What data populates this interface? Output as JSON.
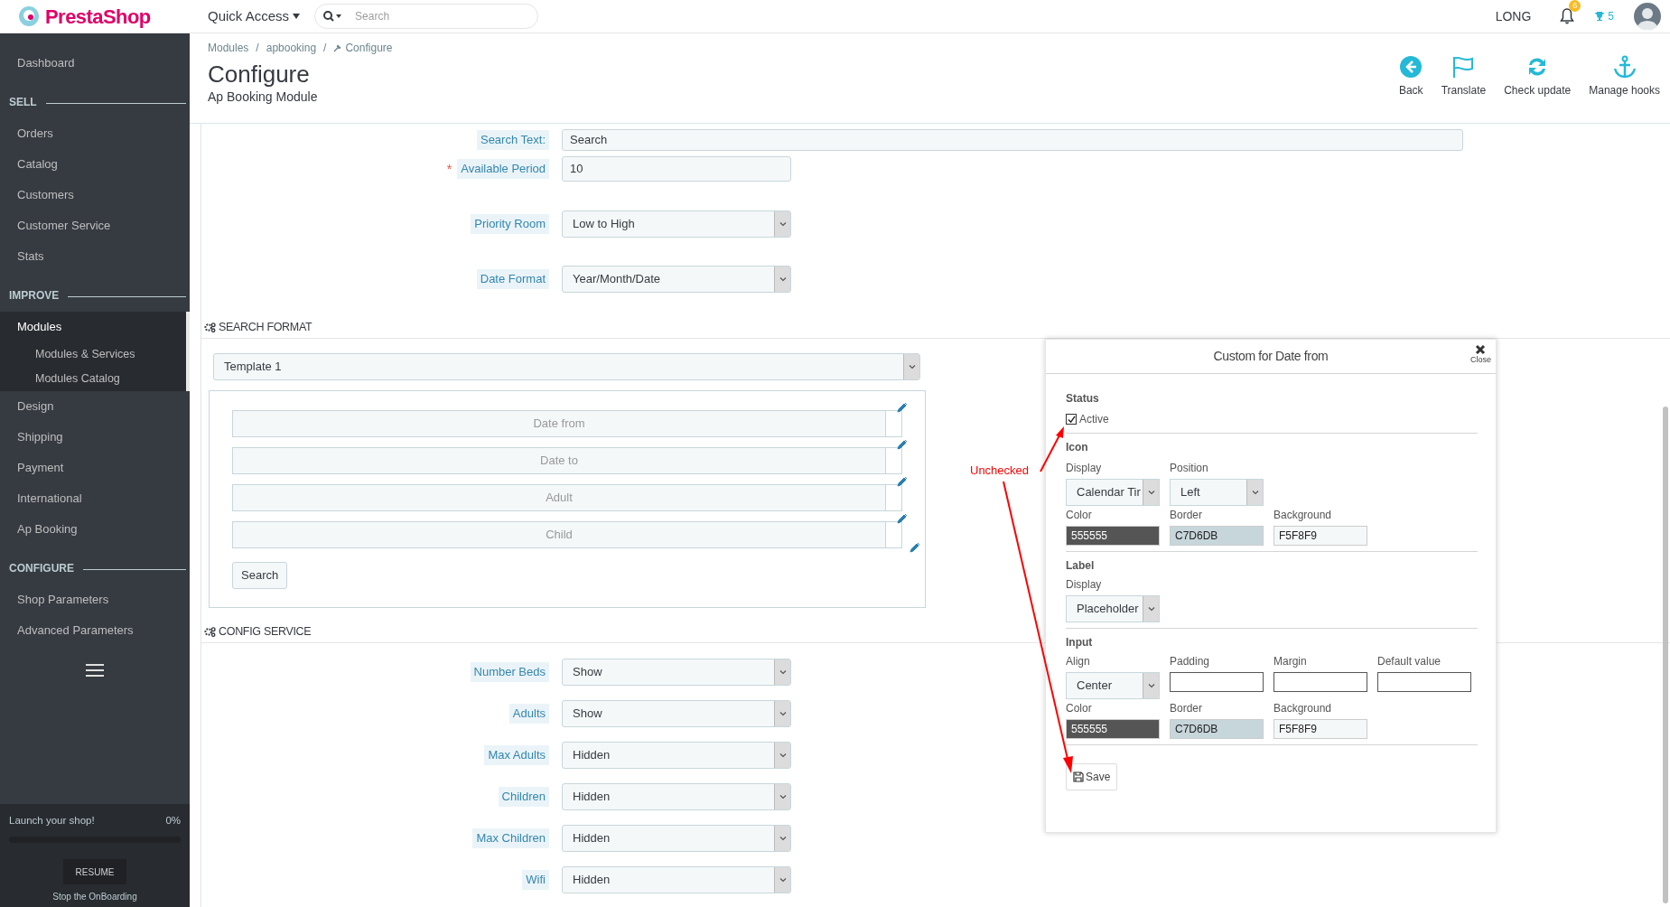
{
  "header": {
    "logo": "PrestaShop",
    "quick_access": "Quick Access",
    "search": {
      "placeholder": "Search"
    },
    "user": "LONG",
    "notifications": {
      "badge": "6"
    },
    "trophies": "5"
  },
  "sidebar": {
    "items": [
      {
        "kind": "link",
        "label": "Dashboard",
        "selected": false
      },
      {
        "kind": "section",
        "label": "SELL"
      },
      {
        "kind": "link",
        "label": "Orders",
        "selected": false
      },
      {
        "kind": "link",
        "label": "Catalog",
        "selected": false
      },
      {
        "kind": "link",
        "label": "Customers",
        "selected": false
      },
      {
        "kind": "link",
        "label": "Customer Service",
        "selected": false
      },
      {
        "kind": "link",
        "label": "Stats",
        "selected": false
      },
      {
        "kind": "section",
        "label": "IMPROVE"
      },
      {
        "kind": "link",
        "label": "Modules",
        "selected": true,
        "children": [
          {
            "label": "Modules & Services",
            "selected": false
          },
          {
            "label": "Modules Catalog",
            "selected": false
          }
        ]
      },
      {
        "kind": "link",
        "label": "Design",
        "selected": false
      },
      {
        "kind": "link",
        "label": "Shipping",
        "selected": false
      },
      {
        "kind": "link",
        "label": "Payment",
        "selected": false
      },
      {
        "kind": "link",
        "label": "International",
        "selected": false
      },
      {
        "kind": "link",
        "label": "Ap Booking",
        "selected": false
      },
      {
        "kind": "section",
        "label": "CONFIGURE"
      },
      {
        "kind": "link",
        "label": "Shop Parameters",
        "selected": false
      },
      {
        "kind": "link",
        "label": "Advanced Parameters",
        "selected": false
      }
    ],
    "onboarding": {
      "label": "Launch your shop!",
      "percent": "0%",
      "button": "RESUME",
      "stop": "Stop the OnBoarding"
    }
  },
  "breadcrumb": {
    "items": [
      "Modules",
      "apbooking",
      "Configure"
    ],
    "separator": "/"
  },
  "page_title": "Configure",
  "subtitle": "Ap Booking Module",
  "toolbar": [
    {
      "kind": "back",
      "label": "Back"
    },
    {
      "kind": "flag",
      "label": "Translate"
    },
    {
      "kind": "refresh",
      "label": "Check update"
    },
    {
      "kind": "anchor",
      "label": "Manage hooks"
    }
  ],
  "general_form": [
    {
      "kind": "text",
      "label": "Search Text:",
      "value": "Search"
    },
    {
      "kind": "text",
      "label": "Available Period",
      "value": "10",
      "required_mark": "*"
    },
    {
      "kind": "select",
      "label": "Priority Room",
      "value": "Low to High"
    },
    {
      "kind": "select",
      "label": "Date Format",
      "value": "Year/Month/Date"
    }
  ],
  "search_format": {
    "title": "SEARCH FORMAT",
    "template": "Template 1",
    "fields": [
      "Date from",
      "Date to",
      "Adult",
      "Child"
    ],
    "button": "Search"
  },
  "config_service": {
    "title": "CONFIG SERVICE",
    "rows": [
      {
        "label": "Number Beds",
        "value": "Show"
      },
      {
        "label": "Adults",
        "value": "Show"
      },
      {
        "label": "Max Adults",
        "value": "Hidden"
      },
      {
        "label": "Children",
        "value": "Hidden"
      },
      {
        "label": "Max Children",
        "value": "Hidden"
      },
      {
        "label": "Wifi",
        "value": "Hidden"
      }
    ]
  },
  "dialog": {
    "title": "Custom for Date from",
    "close": "Close",
    "status": {
      "heading": "Status",
      "label": "Active",
      "checked": true
    },
    "icon": {
      "heading": "Icon",
      "display": {
        "label": "Display",
        "value": "Calendar Tir"
      },
      "position": {
        "label": "Position",
        "value": "Left"
      },
      "colors": [
        {
          "label": "Color",
          "value": "555555"
        },
        {
          "label": "Border",
          "value": "C7D6DB"
        },
        {
          "label": "Background",
          "value": "F5F8F9"
        }
      ]
    },
    "label": {
      "heading": "Label",
      "display": {
        "label": "Display",
        "value": "Placeholder"
      }
    },
    "input": {
      "heading": "Input",
      "align": {
        "label": "Align",
        "value": "Center"
      },
      "fields": [
        {
          "label": "Padding"
        },
        {
          "label": "Margin"
        },
        {
          "label": "Default value"
        }
      ],
      "colors": [
        {
          "label": "Color",
          "value": "555555"
        },
        {
          "label": "Border",
          "value": "C7D6DB"
        },
        {
          "label": "Background",
          "value": "F5F8F9"
        }
      ]
    },
    "save": "Save"
  },
  "annotation": {
    "text": "Unchecked"
  }
}
